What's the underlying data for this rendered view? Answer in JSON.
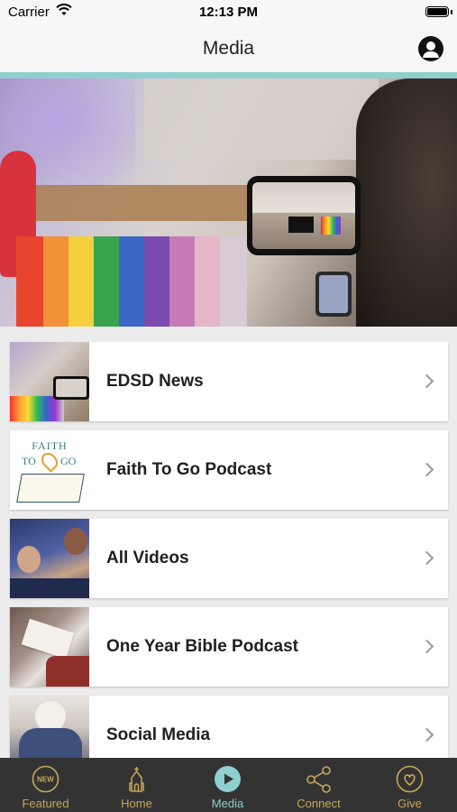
{
  "status_bar": {
    "carrier": "Carrier",
    "time": "12:13 PM"
  },
  "nav": {
    "title": "Media"
  },
  "colors": {
    "accent": "#8fd0cf",
    "tab_inactive": "#c8a85b",
    "tab_bar_bg": "#333333"
  },
  "thumbnail_text": {
    "faith_title": "FAITH",
    "faith_to": "TO",
    "faith_go": "GO"
  },
  "menu": {
    "items": [
      {
        "label": "EDSD News"
      },
      {
        "label": "Faith To Go Podcast"
      },
      {
        "label": "All Videos"
      },
      {
        "label": "One Year Bible Podcast"
      },
      {
        "label": "Social Media"
      }
    ]
  },
  "tabs": [
    {
      "label": "Featured",
      "icon": "new-badge-icon",
      "badge": "NEW"
    },
    {
      "label": "Home",
      "icon": "church-icon"
    },
    {
      "label": "Media",
      "icon": "play-icon",
      "active": true
    },
    {
      "label": "Connect",
      "icon": "share-icon"
    },
    {
      "label": "Give",
      "icon": "heart-icon"
    }
  ]
}
